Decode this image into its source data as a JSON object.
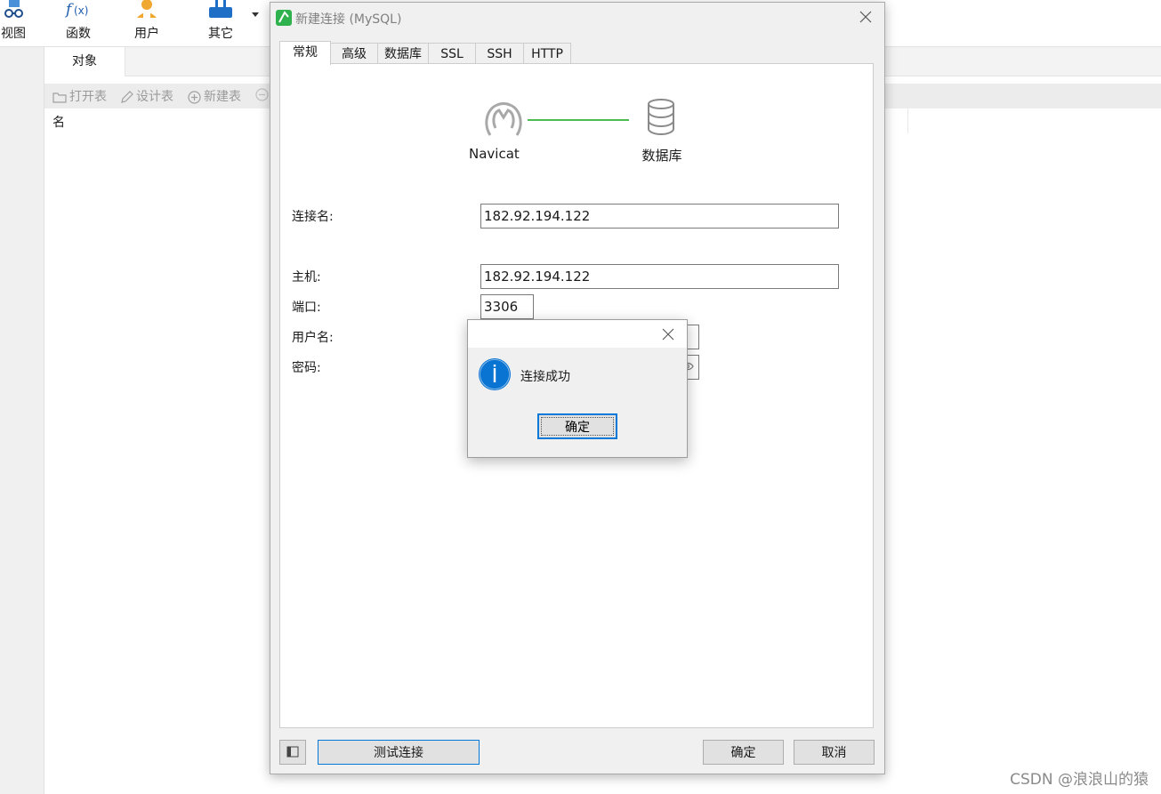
{
  "toolbar": {
    "items": [
      {
        "label": "视图",
        "icon": "glasses-icon"
      },
      {
        "label": "函数",
        "icon": "function-icon"
      },
      {
        "label": "用户",
        "icon": "user-icon"
      },
      {
        "label": "其它",
        "icon": "tools-icon"
      }
    ]
  },
  "objects_tab": {
    "label": "对象"
  },
  "actions": {
    "open_table": "打开表",
    "design_table": "设计表",
    "new_table": "新建表"
  },
  "object_list": {
    "column_name": "名"
  },
  "dialog": {
    "title": "新建连接 (MySQL)",
    "tabs": [
      "常规",
      "高级",
      "数据库",
      "SSL",
      "SSH",
      "HTTP"
    ],
    "active_tab": "常规",
    "diagram": {
      "left_label": "Navicat",
      "right_label": "数据库",
      "line_color": "#4cbb52"
    },
    "fields": {
      "connection_name": {
        "label": "连接名:",
        "value": "182.92.194.122"
      },
      "host": {
        "label": "主机:",
        "value": "182.92.194.122"
      },
      "port": {
        "label": "端口:",
        "value": "3306"
      },
      "username": {
        "label": "用户名:"
      },
      "password": {
        "label": "密码:"
      }
    },
    "buttons": {
      "test": "测试连接",
      "ok": "确定",
      "cancel": "取消"
    }
  },
  "message_box": {
    "text": "连接成功",
    "ok": "确定",
    "icon": "info-icon",
    "accent": "#0078d7"
  },
  "watermark": "CSDN @浪浪山的猿"
}
